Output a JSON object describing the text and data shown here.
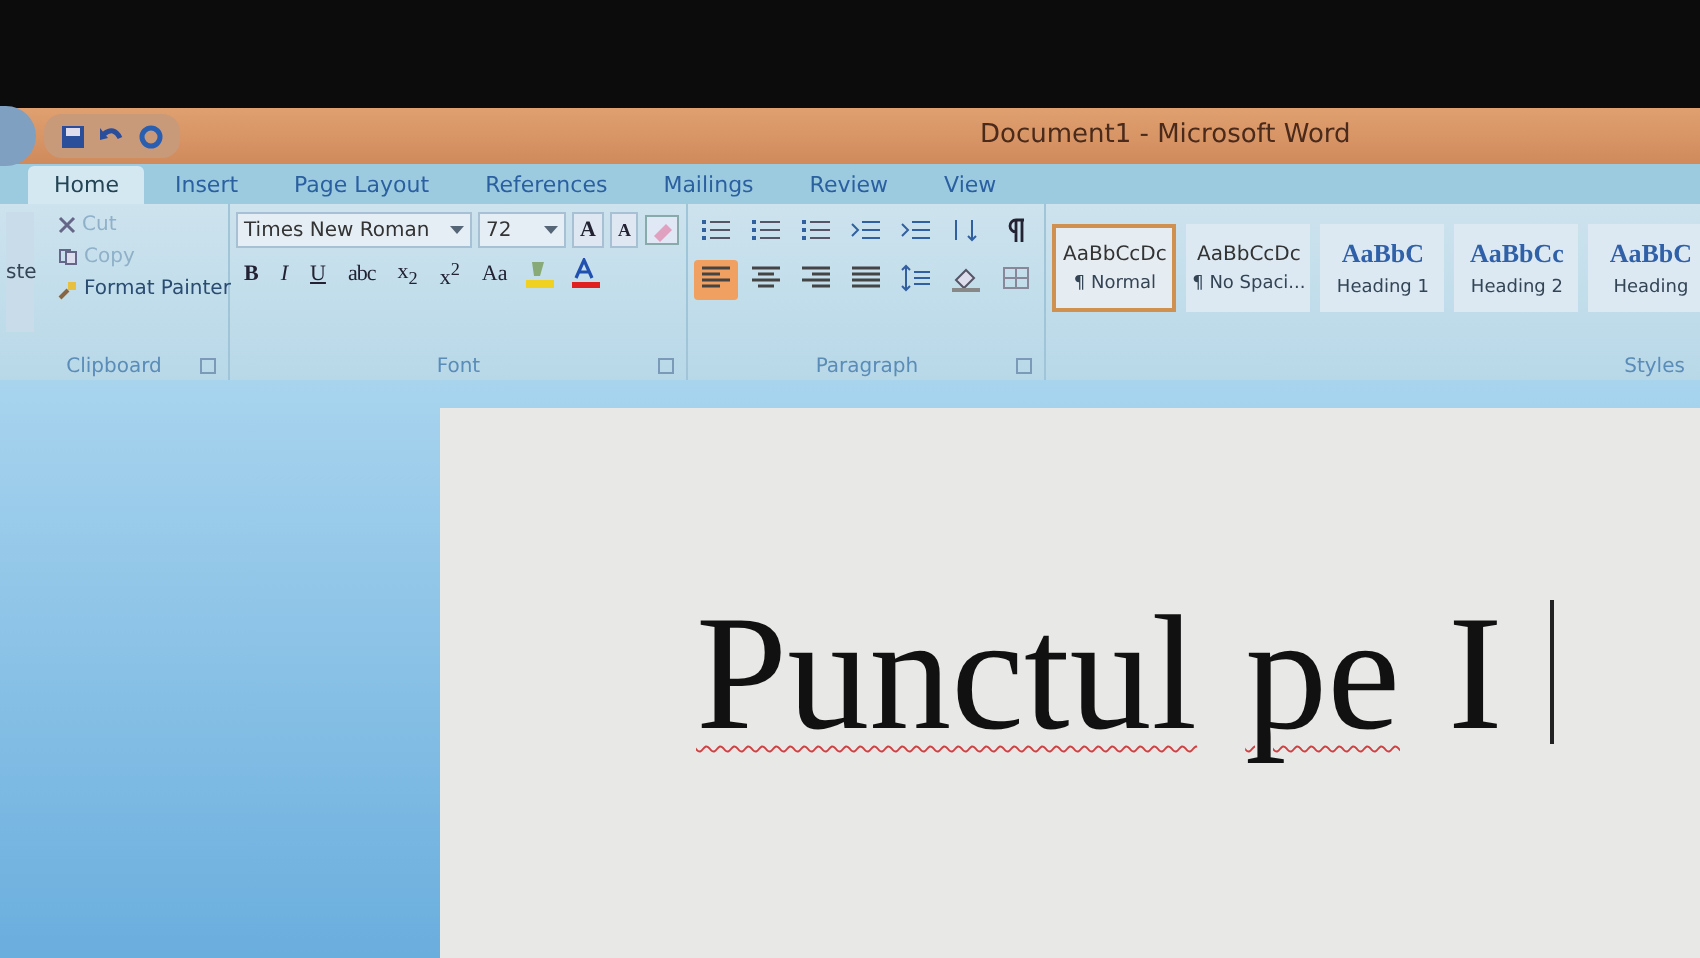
{
  "window": {
    "title": "Document1 - Microsoft Word"
  },
  "tabs": [
    {
      "label": "Home",
      "selected": true
    },
    {
      "label": "Insert",
      "selected": false
    },
    {
      "label": "Page Layout",
      "selected": false
    },
    {
      "label": "References",
      "selected": false
    },
    {
      "label": "Mailings",
      "selected": false
    },
    {
      "label": "Review",
      "selected": false
    },
    {
      "label": "View",
      "selected": false
    }
  ],
  "clipboard": {
    "paste_label": "ste",
    "items": [
      {
        "kind": "cut",
        "label": "Cut",
        "disabled": true
      },
      {
        "kind": "copy",
        "label": "Copy",
        "disabled": true
      },
      {
        "kind": "painter",
        "label": "Format Painter",
        "disabled": false
      }
    ],
    "group_label": "Clipboard"
  },
  "font": {
    "name": "Times New Roman",
    "size": "72",
    "grow_label": "A",
    "shrink_label": "A",
    "format_buttons": [
      {
        "kind": "bold",
        "label": "B"
      },
      {
        "kind": "italic",
        "label": "I"
      },
      {
        "kind": "underline",
        "label": "U"
      },
      {
        "kind": "strike",
        "label": "abc"
      },
      {
        "kind": "plain",
        "label": "x$_{2}$"
      },
      {
        "kind": "plain",
        "label": "x$^{2}$"
      },
      {
        "kind": "plain",
        "label": "Aa"
      }
    ],
    "group_label": "Font"
  },
  "paragraph": {
    "row1": [
      {
        "kind": "bullets",
        "selected": false
      },
      {
        "kind": "numbering",
        "selected": false
      },
      {
        "kind": "multilevel",
        "selected": false
      },
      {
        "kind": "outdent",
        "selected": false
      },
      {
        "kind": "indent",
        "selected": false
      },
      {
        "kind": "sort",
        "selected": false
      },
      {
        "kind": "pilcrow",
        "selected": false
      }
    ],
    "row2": [
      {
        "kind": "align-left",
        "selected": true
      },
      {
        "kind": "align-center",
        "selected": false
      },
      {
        "kind": "align-right",
        "selected": false
      },
      {
        "kind": "justify",
        "selected": false
      },
      {
        "kind": "spacing",
        "selected": false
      },
      {
        "kind": "shading",
        "selected": false
      },
      {
        "kind": "borders",
        "selected": false
      }
    ],
    "group_label": "Paragraph"
  },
  "styles": {
    "items": [
      {
        "preview": "AaBbCcDc",
        "name": "¶ Normal",
        "kind": "body",
        "selected": true
      },
      {
        "preview": "AaBbCcDc",
        "name": "¶ No Spaci...",
        "kind": "body",
        "selected": false
      },
      {
        "preview": "AaBbC",
        "name": "Heading 1",
        "kind": "heading",
        "selected": false
      },
      {
        "preview": "AaBbCc",
        "name": "Heading 2",
        "kind": "heading",
        "selected": false
      },
      {
        "preview": "AaBbC",
        "name": "Heading",
        "kind": "heading",
        "selected": false
      }
    ],
    "group_label": "Styles"
  },
  "document": {
    "words": [
      {
        "text": "Punctul",
        "misspelled": true
      },
      {
        "text": "pe",
        "misspelled": true
      },
      {
        "text": "I",
        "misspelled": false
      }
    ]
  }
}
